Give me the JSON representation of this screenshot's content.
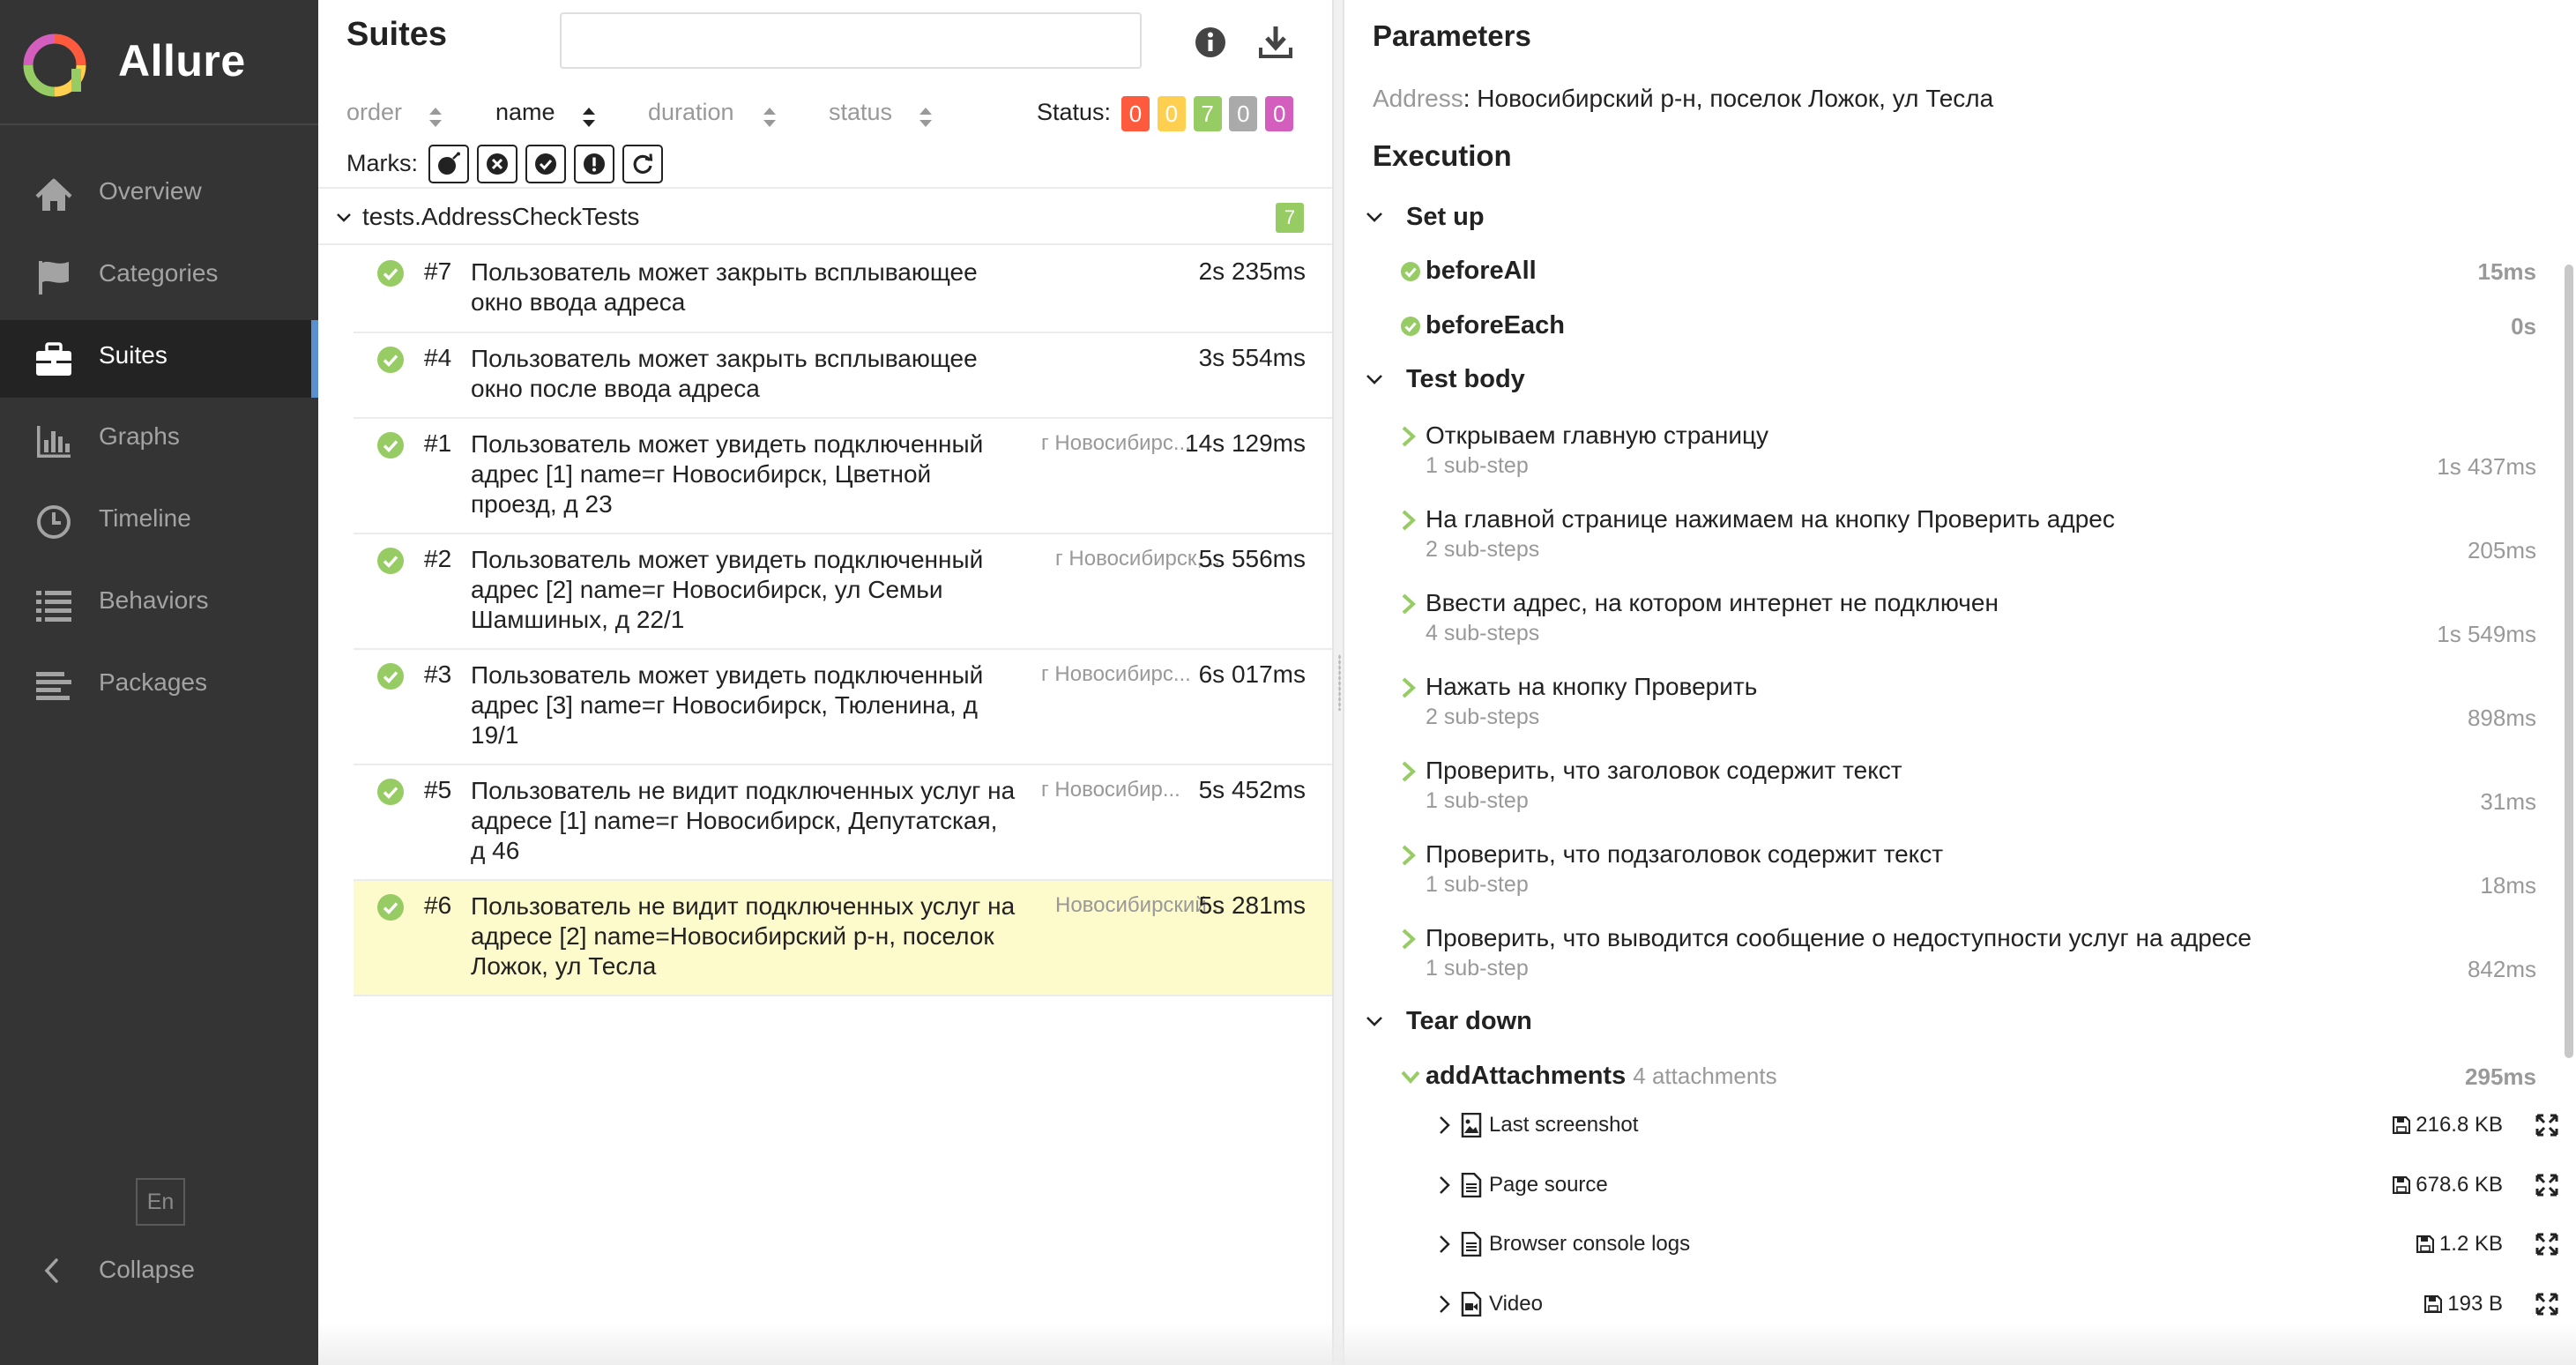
{
  "brand": {
    "name": "Allure"
  },
  "nav": [
    {
      "label": "Overview",
      "icon": "home-icon"
    },
    {
      "label": "Categories",
      "icon": "flag-icon"
    },
    {
      "label": "Suites",
      "icon": "briefcase-icon",
      "active": true
    },
    {
      "label": "Graphs",
      "icon": "bar-chart-icon"
    },
    {
      "label": "Timeline",
      "icon": "clock-icon"
    },
    {
      "label": "Behaviors",
      "icon": "list-icon"
    },
    {
      "label": "Packages",
      "icon": "align-left-icon"
    }
  ],
  "language": "En",
  "collapse_label": "Collapse",
  "suites": {
    "title": "Suites",
    "search_placeholder": "",
    "sort": [
      "order",
      "name",
      "duration",
      "status"
    ],
    "status_label": "Status:",
    "status_counts": [
      {
        "value": "0",
        "color": "#fd5a3e",
        "name": "failed"
      },
      {
        "value": "0",
        "color": "#ffd050",
        "name": "broken"
      },
      {
        "value": "7",
        "color": "#97cc64",
        "name": "passed"
      },
      {
        "value": "0",
        "color": "#aaaaaa",
        "name": "skipped"
      },
      {
        "value": "0",
        "color": "#d35ebe",
        "name": "unknown"
      }
    ],
    "marks_label": "Marks:",
    "group": {
      "name": "tests.AddressCheckTests",
      "count": "7"
    },
    "tests": [
      {
        "num": "#7",
        "name": "Пользователь может закрыть всплывающее окно ввода адреса",
        "param": "",
        "duration": "2s 235ms"
      },
      {
        "num": "#4",
        "name": "Пользователь может закрыть всплывающее окно после ввода адреса",
        "param": "",
        "duration": "3s 554ms"
      },
      {
        "num": "#1",
        "name": "Пользователь может увидеть подключенный адрес [1] name=г Новосибирск, Цветной проезд, д 23",
        "param": "г Новосибирс...",
        "duration": "14s 129ms"
      },
      {
        "num": "#2",
        "name": "Пользователь может увидеть подключенный адрес [2] name=г Новосибирск, ул Семьи Шамшиных, д 22/1",
        "param": "г Новосибирск, ...",
        "duration": "5s 556ms"
      },
      {
        "num": "#3",
        "name": "Пользователь может увидеть подключенный адрес [3] name=г Новосибирск, Тюленина, д 19/1",
        "param": "г Новосибирс...",
        "duration": "6s 017ms"
      },
      {
        "num": "#5",
        "name": "Пользователь не видит подключенных услуг на адресе [1] name=г Новосибирск, Депутатская, д 46",
        "param": "г Новосибир...",
        "duration": "5s 452ms"
      },
      {
        "num": "#6",
        "name": "Пользователь не видит подключенных услуг на адресе [2] name=Новосибирский р-н, поселок Ложок, ул Тесла",
        "param": "Новосибирский...",
        "duration": "5s 281ms",
        "selected": true
      }
    ]
  },
  "details": {
    "parameters_title": "Parameters",
    "param_key": "Address",
    "param_value": ": Новосибирский р-н, поселок Ложок, ул Тесла",
    "execution_title": "Execution",
    "setup_label": "Set up",
    "setup": [
      {
        "name": "beforeAll",
        "duration": "15ms"
      },
      {
        "name": "beforeEach",
        "duration": "0s"
      }
    ],
    "body_label": "Test body",
    "steps": [
      {
        "name": "Открываем главную страницу",
        "sub": "1 sub-step",
        "duration": "1s 437ms"
      },
      {
        "name": "На главной странице нажимаем на кнопку Проверить адрес",
        "sub": "2 sub-steps",
        "duration": "205ms"
      },
      {
        "name": "Ввести адрес, на котором интернет не подключен",
        "sub": "4 sub-steps",
        "duration": "1s 549ms"
      },
      {
        "name": "Нажать на кнопку Проверить",
        "sub": "2 sub-steps",
        "duration": "898ms"
      },
      {
        "name": "Проверить, что заголовок содержит текст",
        "sub": "1 sub-step",
        "duration": "31ms"
      },
      {
        "name": "Проверить, что подзаголовок содержит текст",
        "sub": "1 sub-step",
        "duration": "18ms"
      },
      {
        "name": "Проверить, что выводится сообщение о недоступности услуг на адресе",
        "sub": "1 sub-step",
        "duration": "842ms"
      }
    ],
    "teardown_label": "Tear down",
    "teardown": {
      "name": "addAttachments",
      "extra": "4 attachments",
      "duration": "295ms"
    },
    "attachments": [
      {
        "name": "Last screenshot",
        "size": "216.8 KB",
        "icon": "image-file-icon"
      },
      {
        "name": "Page source",
        "size": "678.6 KB",
        "icon": "text-file-icon"
      },
      {
        "name": "Browser console logs",
        "size": "1.2 KB",
        "icon": "text-file-icon"
      },
      {
        "name": "Video",
        "size": "193 B",
        "icon": "video-file-icon"
      }
    ]
  }
}
